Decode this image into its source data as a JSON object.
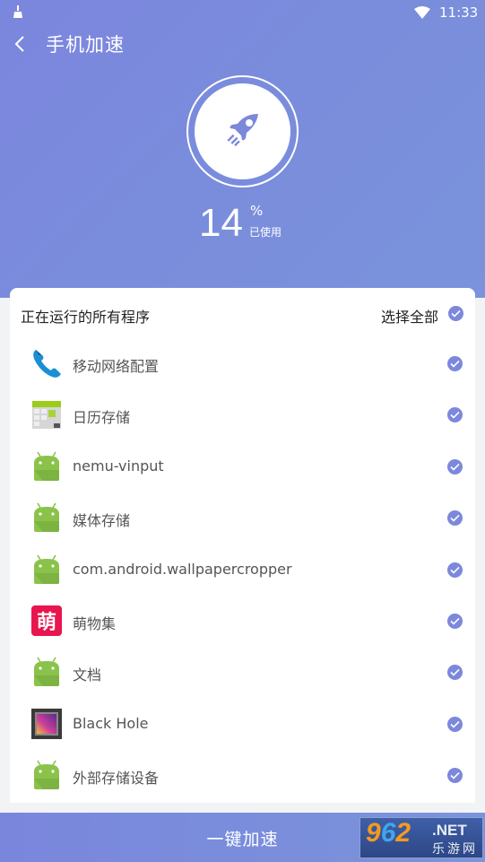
{
  "status_bar": {
    "left_icon": "cleaner-broom-icon",
    "wifi_icon": "wifi-icon",
    "time": "11:33"
  },
  "toolbar": {
    "back_icon": "chevron-left-icon",
    "title": "手机加速"
  },
  "hero": {
    "icon": "rocket-icon",
    "usage_percent": 14,
    "usage_value": "14",
    "usage_unit": "%",
    "usage_label": "已使用"
  },
  "running_apps": {
    "title": "正在运行的所有程序",
    "select_all_label": "选择全部",
    "select_all_checked": true,
    "accent_color": "#7c88dc",
    "items": [
      {
        "name": "移动网络配置",
        "icon": "phone-icon",
        "checked": true
      },
      {
        "name": "日历存储",
        "icon": "calendar-icon",
        "checked": true
      },
      {
        "name": "nemu-vinput",
        "icon": "android-icon",
        "checked": true
      },
      {
        "name": "媒体存储",
        "icon": "android-icon",
        "checked": true
      },
      {
        "name": "com.android.wallpapercropper",
        "icon": "android-icon",
        "checked": true
      },
      {
        "name": "萌物集",
        "icon": "mengwuji-app-icon",
        "checked": true
      },
      {
        "name": "文档",
        "icon": "android-icon",
        "checked": true
      },
      {
        "name": "Black Hole",
        "icon": "black-hole-app-icon",
        "checked": true
      },
      {
        "name": "外部存储设备",
        "icon": "android-icon",
        "checked": true
      }
    ]
  },
  "bottom": {
    "boost_label": "一键加速"
  },
  "watermark": {
    "number": "962",
    "suffix": ".NET",
    "subtitle": "乐游网",
    "meng_char": "萌"
  }
}
